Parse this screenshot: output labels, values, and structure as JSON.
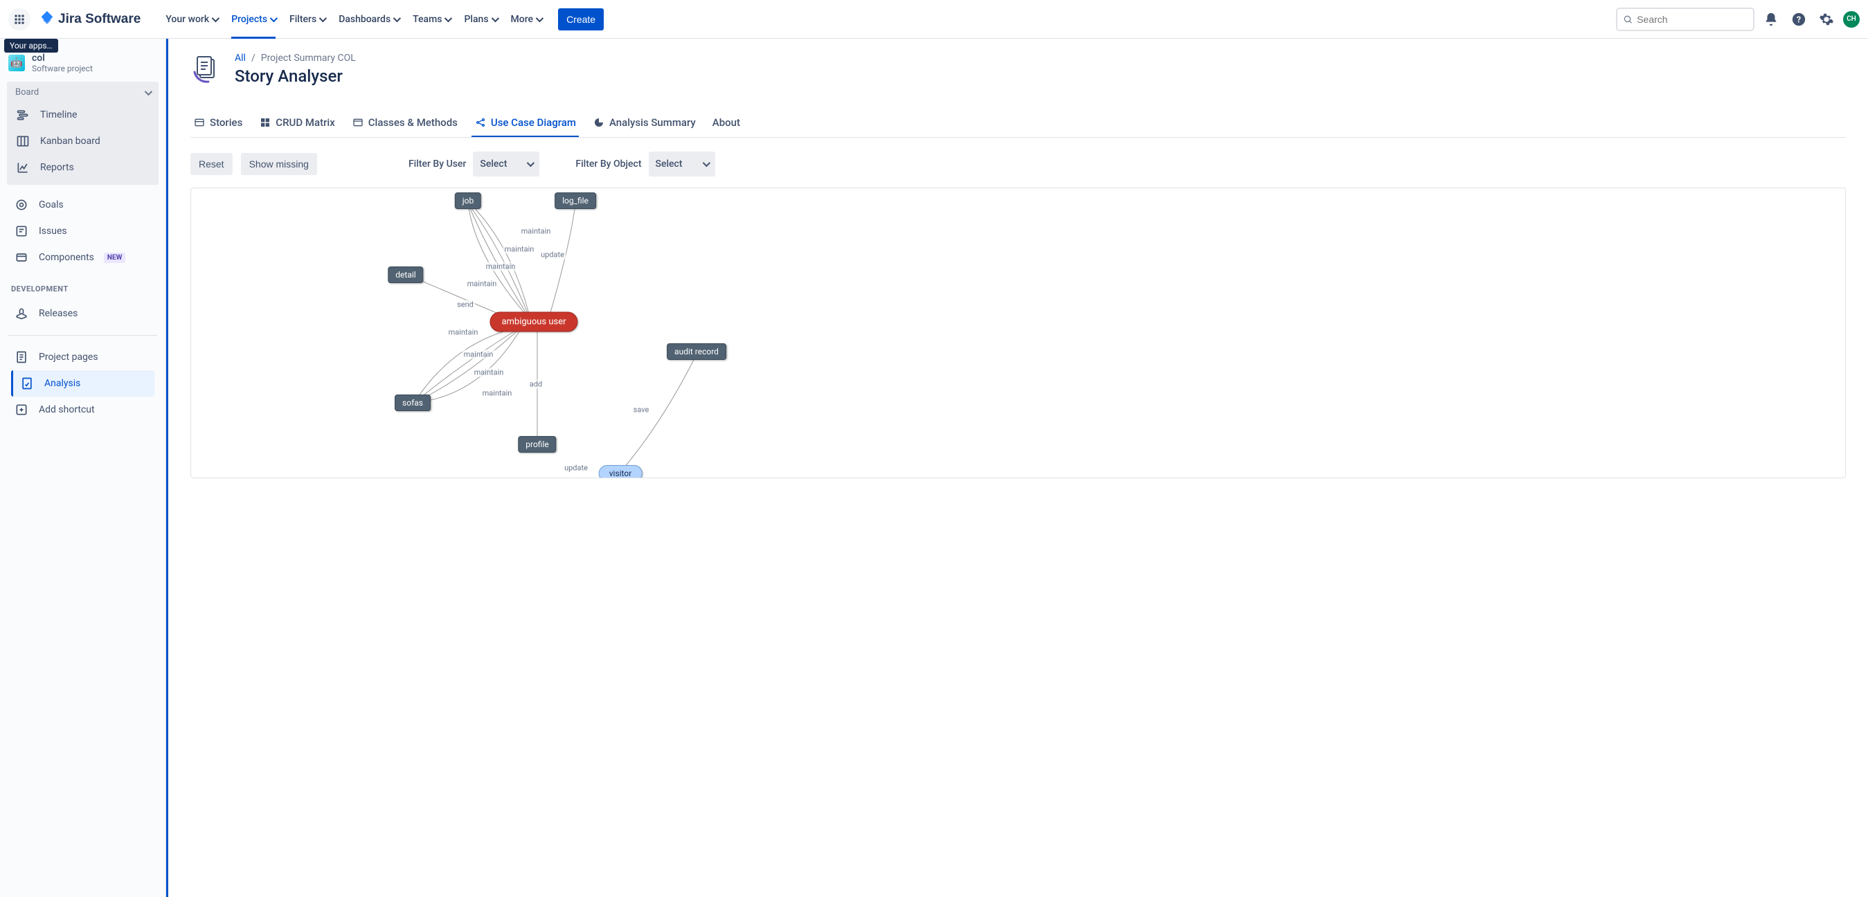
{
  "header": {
    "product": "Jira Software",
    "nav": {
      "your_work": "Your work",
      "projects": "Projects",
      "filters": "Filters",
      "dashboards": "Dashboards",
      "teams": "Teams",
      "plans": "Plans",
      "more": "More"
    },
    "create": "Create",
    "search_placeholder": "Search",
    "avatar": "CH",
    "tooltip": "Your apps…"
  },
  "sidebar": {
    "project_name": "col",
    "project_type": "Software project",
    "board_label": "Board",
    "items": {
      "timeline": "Timeline",
      "kanban": "Kanban board",
      "reports": "Reports",
      "goals": "Goals",
      "issues": "Issues",
      "components": "Components",
      "components_badge": "NEW",
      "development": "DEVELOPMENT",
      "releases": "Releases",
      "project_pages": "Project pages",
      "analysis": "Analysis",
      "add_shortcut": "Add shortcut"
    }
  },
  "breadcrumb": {
    "all": "All",
    "current": "Project Summary COL"
  },
  "page_title": "Story Analyser",
  "tabs": {
    "stories": "Stories",
    "crud": "CRUD Matrix",
    "classes": "Classes & Methods",
    "usecase": "Use Case Diagram",
    "summary": "Analysis Summary",
    "about": "About"
  },
  "toolbar": {
    "reset": "Reset",
    "show_missing": "Show missing",
    "filter_user": "Filter By User",
    "filter_object": "Filter By Object",
    "select": "Select"
  },
  "diagram": {
    "nodes": {
      "ambiguous_user": "ambiguous user",
      "job": "job",
      "log_file": "log_file",
      "detail": "detail",
      "sofas": "sofas",
      "profile": "profile",
      "audit_record": "audit record",
      "visitor": "visitor"
    },
    "edges": {
      "maintain": "maintain",
      "update": "update",
      "send": "send",
      "add": "add",
      "save": "save"
    }
  }
}
